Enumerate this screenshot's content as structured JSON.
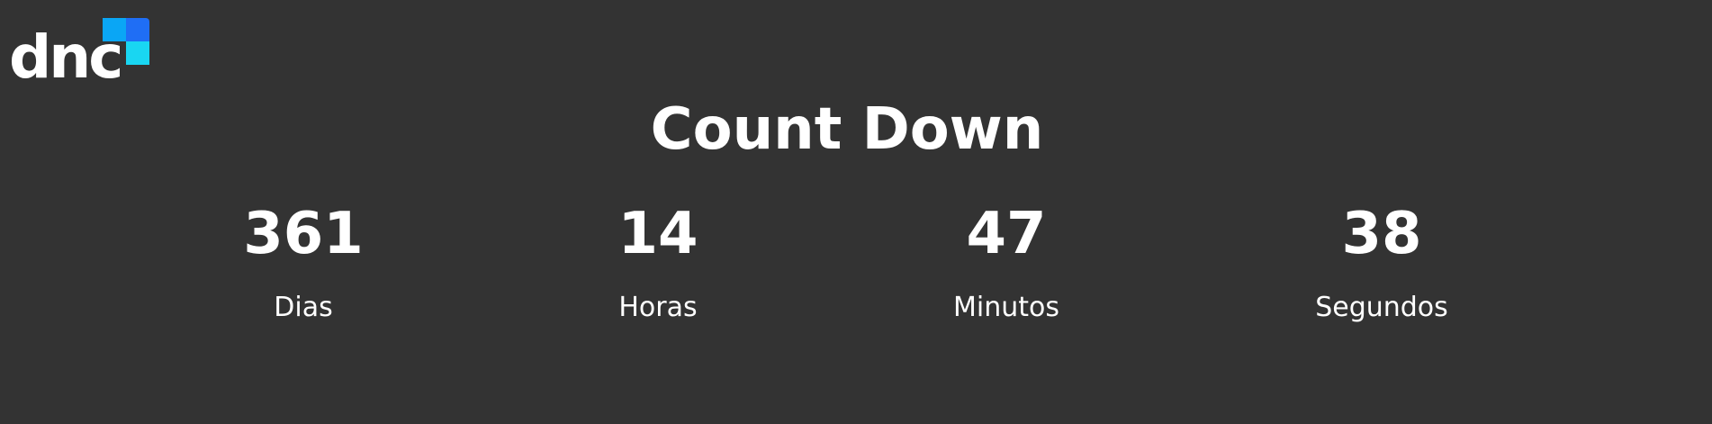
{
  "logo": {
    "text": "dnc",
    "colors": {
      "top_left": "#0aa6f5",
      "top_right": "#1f6ef5",
      "bottom_right": "#19d6f2"
    }
  },
  "title": "Count Down",
  "countdown": [
    {
      "value": "361",
      "label": "Dias"
    },
    {
      "value": "14",
      "label": "Horas"
    },
    {
      "value": "47",
      "label": "Minutos"
    },
    {
      "value": "38",
      "label": "Segundos"
    }
  ],
  "colors": {
    "background": "#333333",
    "text": "#ffffff"
  }
}
